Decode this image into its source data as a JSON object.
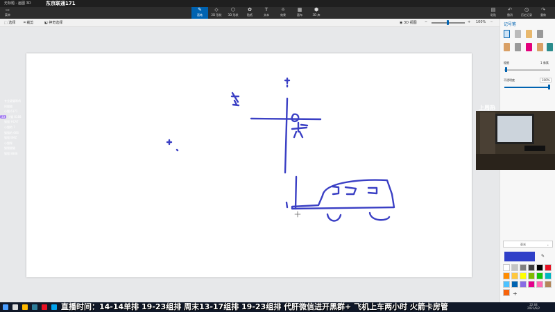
{
  "window": {
    "app_title": "无标题 - 画图 3D",
    "stream_title": "东京联通171"
  },
  "ribbon": {
    "menu_label": "菜单",
    "tools": [
      {
        "label": "画笔",
        "icon": "brush-icon",
        "glyph": "✎"
      },
      {
        "label": "2D 形状",
        "icon": "shapes-2d-icon",
        "glyph": "◇"
      },
      {
        "label": "3D 形状",
        "icon": "shapes-3d-icon",
        "glyph": "⬡"
      },
      {
        "label": "贴纸",
        "icon": "sticker-icon",
        "glyph": "✿"
      },
      {
        "label": "文本",
        "icon": "text-icon",
        "glyph": "T"
      },
      {
        "label": "效果",
        "icon": "effects-icon",
        "glyph": "☼"
      },
      {
        "label": "画布",
        "icon": "canvas-icon",
        "glyph": "▦"
      },
      {
        "label": "3D 库",
        "icon": "library-3d-icon",
        "glyph": "⬢"
      }
    ],
    "right_tools": [
      {
        "label": "粘贴",
        "icon": "paste-icon",
        "glyph": "▤"
      },
      {
        "label": "撤消",
        "icon": "undo-icon",
        "glyph": "↶"
      },
      {
        "label": "历史记录",
        "icon": "history-icon",
        "glyph": "◷"
      },
      {
        "label": "重做",
        "icon": "redo-icon",
        "glyph": "↷"
      }
    ]
  },
  "subbar": {
    "select": "选择",
    "crop": "裁剪",
    "magic_select": "神奇选择",
    "view_3d": "3D 视图",
    "zoom": "100%"
  },
  "panel": {
    "title": "记号笔",
    "thickness_label": "粗细",
    "thickness_value": "1 像素",
    "opacity_label": "不透明度",
    "opacity_value": "100%",
    "matte_label": "亚光",
    "current_color": "#2f3fc8",
    "swatch_colors": [
      "#ffffff",
      "#c3c3c3",
      "#7f7f7f",
      "#3f3f3f",
      "#000000",
      "#e81123",
      "#ff8c00",
      "#ffc83d",
      "#ffff00",
      "#7fba00",
      "#16c60c",
      "#00b7c3",
      "#4cc2ff",
      "#0063b1",
      "#886ce4",
      "#e3008c",
      "#ff69b4",
      "#b4875a",
      "#f7630c"
    ]
  },
  "chat": [
    {
      "badge": "",
      "text": "专业级猫咪鸡",
      "badge_color": "#555"
    },
    {
      "badge": "",
      "text": "阿猫猫",
      "badge_color": "#555"
    },
    {
      "badge": "",
      "text": "小猫 6171",
      "badge_color": "#555"
    },
    {
      "badge": "33",
      "text": "小猫 8188",
      "badge_color": "#a37cf0"
    },
    {
      "badge": "",
      "text": "猫猫 #CAT",
      "badge_color": "#555"
    },
    {
      "badge": "",
      "text": "小猫的 7",
      "badge_color": "#555"
    },
    {
      "badge": "",
      "text": "猫猫的 666",
      "badge_color": "#555"
    },
    {
      "badge": "",
      "text": "猫猫 BMZ",
      "badge_color": "#3a7bd5"
    },
    {
      "badge": "",
      "text": "小猫咪",
      "badge_color": "#555"
    },
    {
      "badge": "",
      "text": "猫猫猫猫",
      "badge_color": "#555"
    },
    {
      "badge": "",
      "text": "猫猫 8888",
      "badge_color": "#6ad0d0"
    }
  ],
  "webcam": {
    "label": "上周热"
  },
  "marquee": "直播时间：14-14单排 19-23组排 周末13-17组排 19-23组排 代肝微信进开黑群+ 飞机上车两小时 火箭卡房管",
  "clock": {
    "time": "22:04",
    "date": "2021/6/2"
  },
  "drawing": {
    "stroke_color": "#3a3fc4"
  }
}
